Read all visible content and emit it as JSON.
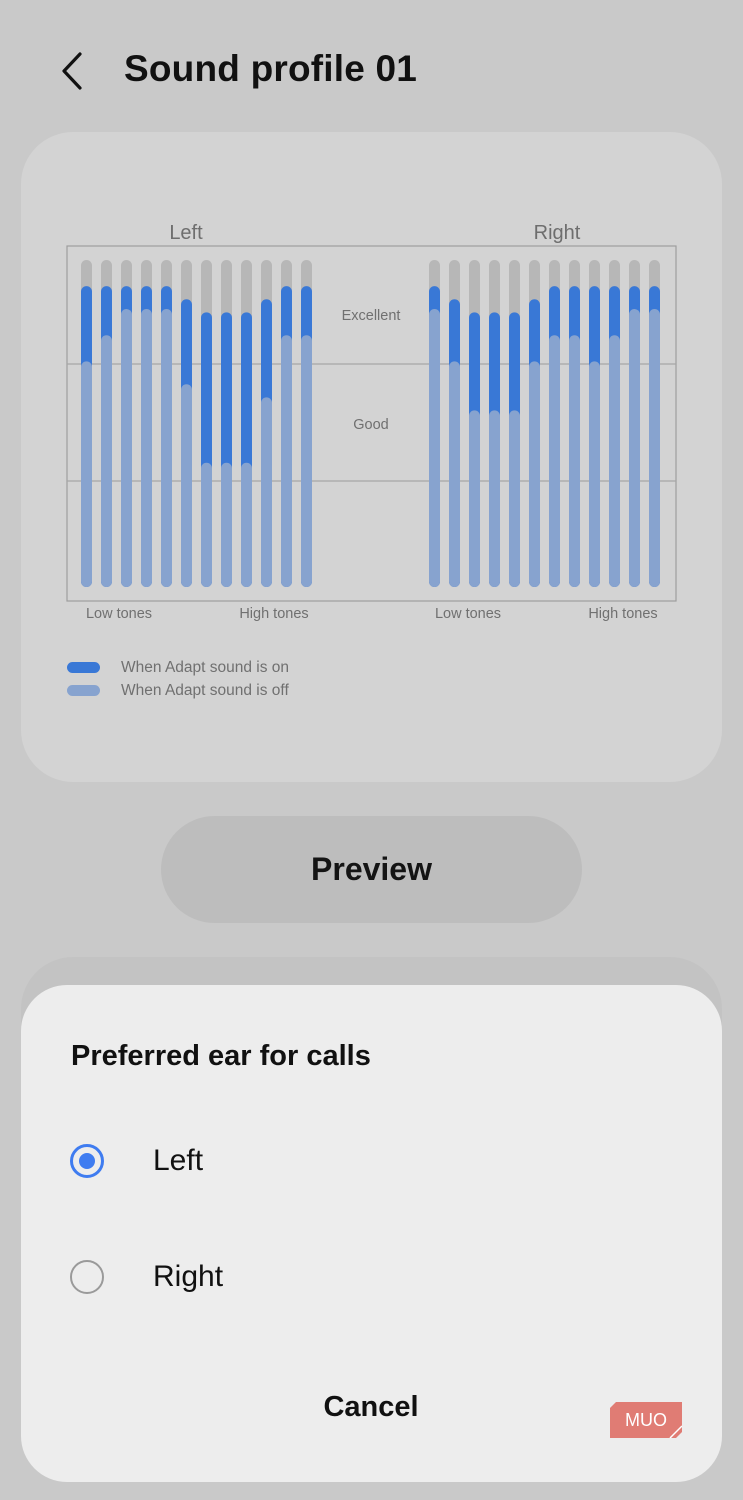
{
  "header": {
    "title": "Sound profile 01",
    "back_icon": "chevron-left-icon"
  },
  "colors": {
    "on": "#3978d6",
    "off": "#87a3cf",
    "bg_bar": "#b7b7b7",
    "accent": "#3f7cf0"
  },
  "chart_data": {
    "type": "bar",
    "levels": [
      "Excellent",
      "Good"
    ],
    "left": {
      "title": "Left",
      "x_start_label": "Low tones",
      "x_end_label": "High tones",
      "adapt_on": [
        0.92,
        0.92,
        0.92,
        0.92,
        0.92,
        0.88,
        0.84,
        0.84,
        0.84,
        0.88,
        0.92,
        0.92
      ],
      "adapt_off": [
        0.69,
        0.77,
        0.85,
        0.85,
        0.85,
        0.62,
        0.38,
        0.38,
        0.38,
        0.58,
        0.77,
        0.77
      ]
    },
    "right": {
      "title": "Right",
      "x_start_label": "Low tones",
      "x_end_label": "High tones",
      "adapt_on": [
        0.92,
        0.88,
        0.84,
        0.84,
        0.84,
        0.88,
        0.92,
        0.92,
        0.92,
        0.92,
        0.92,
        0.92
      ],
      "adapt_off": [
        0.85,
        0.69,
        0.54,
        0.54,
        0.54,
        0.69,
        0.77,
        0.77,
        0.69,
        0.77,
        0.85,
        0.85
      ]
    },
    "legend": [
      {
        "label": "When Adapt sound is on",
        "color": "#3978d6"
      },
      {
        "label": "When Adapt sound is off",
        "color": "#87a3cf"
      }
    ]
  },
  "preview_button": {
    "label": "Preview"
  },
  "dialog": {
    "title": "Preferred ear for calls",
    "options": [
      {
        "label": "Left",
        "selected": true
      },
      {
        "label": "Right",
        "selected": false
      }
    ],
    "cancel_label": "Cancel"
  },
  "watermark": {
    "text": "MUO"
  }
}
